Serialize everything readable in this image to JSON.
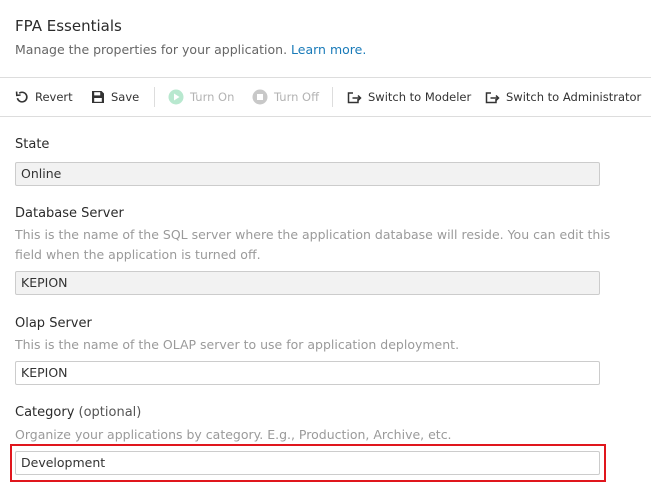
{
  "header": {
    "title": "FPA Essentials",
    "subtitle": "Manage the properties for your application.",
    "learn_more": "Learn more."
  },
  "toolbar": {
    "revert": "Revert",
    "save": "Save",
    "turn_on": "Turn On",
    "turn_off": "Turn Off",
    "switch_modeler": "Switch to Modeler",
    "switch_admin": "Switch to Administrator"
  },
  "fields": {
    "state": {
      "label": "State",
      "value": "Online"
    },
    "database_server": {
      "label": "Database Server",
      "help": "This is the name of the SQL server where the application database will reside. You can edit this field when the application is turned off.",
      "value": "KEPION"
    },
    "olap_server": {
      "label": "Olap Server",
      "help": "This is the name of the OLAP server to use for application deployment.",
      "value": "KEPION"
    },
    "category": {
      "label": "Category",
      "optional": "(optional)",
      "help": "Organize your applications by category. E.g., Production, Archive, etc.",
      "value": "Development"
    }
  },
  "colors": {
    "link": "#1a7bb9",
    "highlight": "#e0161d",
    "disabled_icon": "#b8e8cf",
    "readonly_bg": "#f2f2f2"
  },
  "icons": {
    "revert": "revert-icon",
    "save": "save-icon",
    "turn_on": "play-circle-icon",
    "turn_off": "stop-circle-icon",
    "switch": "switch-arrow-icon"
  }
}
